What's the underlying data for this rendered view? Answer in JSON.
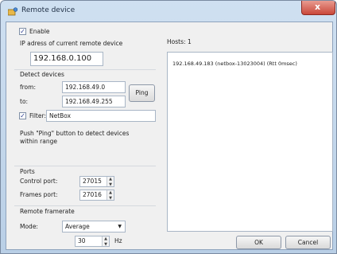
{
  "window": {
    "title": "Remote device",
    "close_glyph": "x"
  },
  "left": {
    "enable_label": "Enable",
    "enable_checked": true,
    "ip_label": "IP adress of current remote device",
    "ip_value": "192.168.0.100",
    "detect_title": "Detect devices",
    "from_label": "from:",
    "from_value": "192.168.49.0",
    "to_label": "to:",
    "to_value": "192.168.49.255",
    "ping_label": "Ping",
    "filter_label": "Filter:",
    "filter_checked": true,
    "filter_value": "NetBox",
    "hint_line1": "Push \"Ping\" button to detect devices",
    "hint_line2": "within range",
    "ports_title": "Ports",
    "control_port_label": "Control port:",
    "control_port_value": "27015",
    "frames_port_label": "Frames port:",
    "frames_port_value": "27016",
    "framerate_title": "Remote framerate",
    "mode_label": "Mode:",
    "mode_value": "Average",
    "rate_value": "30",
    "rate_unit": "Hz"
  },
  "right": {
    "hosts_label": "Hosts:",
    "hosts_count": "1",
    "hosts": [
      "192.168.49.183 (netbox-13023004) (Rtt 0msec)"
    ]
  },
  "buttons": {
    "ok_label": "OK",
    "cancel_label": "Cancel"
  },
  "icons": {
    "app": "device-icon",
    "checkbox": "check-icon",
    "spin": "spin-arrows-icon",
    "dropdown": "dropdown-arrow-icon"
  }
}
